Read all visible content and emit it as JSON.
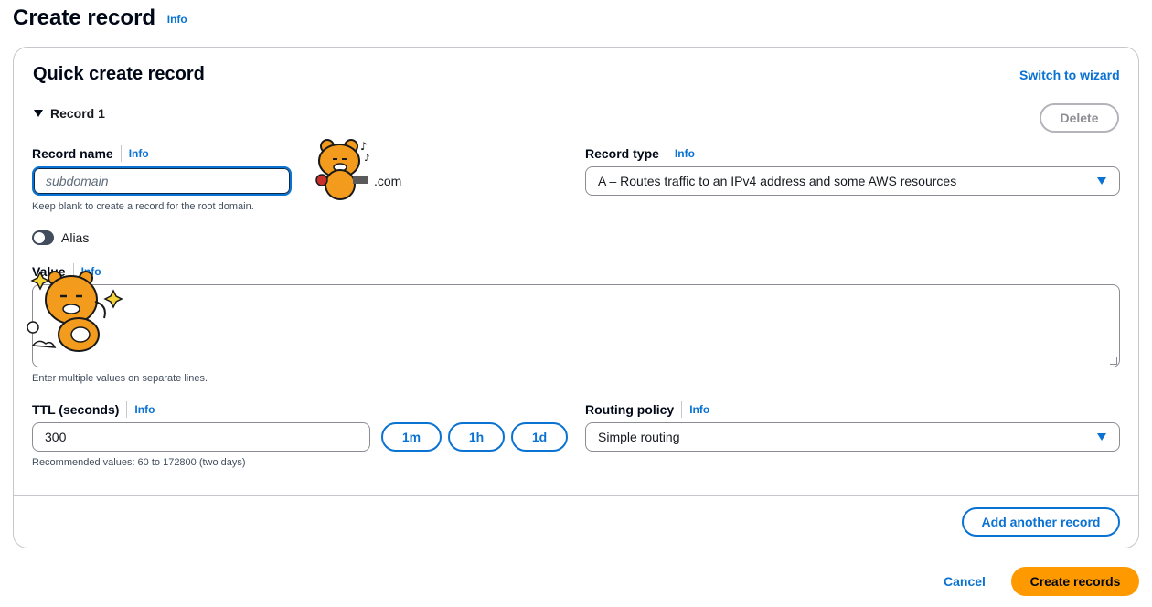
{
  "page": {
    "title": "Create record",
    "info": "Info"
  },
  "card": {
    "title": "Quick create record",
    "switch_to_wizard": "Switch to wizard"
  },
  "record": {
    "header": "Record 1",
    "delete_label": "Delete",
    "record_name": {
      "label": "Record name",
      "info": "Info",
      "placeholder": "subdomain",
      "domain_suffix": ".com",
      "hint": "Keep blank to create a record for the root domain."
    },
    "record_type": {
      "label": "Record type",
      "info": "Info",
      "value": "A – Routes traffic to an IPv4 address and some AWS resources"
    },
    "alias": {
      "label": "Alias",
      "enabled": false
    },
    "value": {
      "label": "Value",
      "info": "Info",
      "hint": "Enter multiple values on separate lines."
    },
    "ttl": {
      "label": "TTL (seconds)",
      "info": "Info",
      "value": "300",
      "presets": [
        "1m",
        "1h",
        "1d"
      ],
      "hint": "Recommended values: 60 to 172800 (two days)"
    },
    "routing_policy": {
      "label": "Routing policy",
      "info": "Info",
      "value": "Simple routing"
    }
  },
  "add_another_record": "Add another record",
  "footer": {
    "cancel": "Cancel",
    "create": "Create records"
  },
  "colors": {
    "accent": "#0972d3",
    "primary": "#ff9900",
    "border": "#8c8c94"
  }
}
